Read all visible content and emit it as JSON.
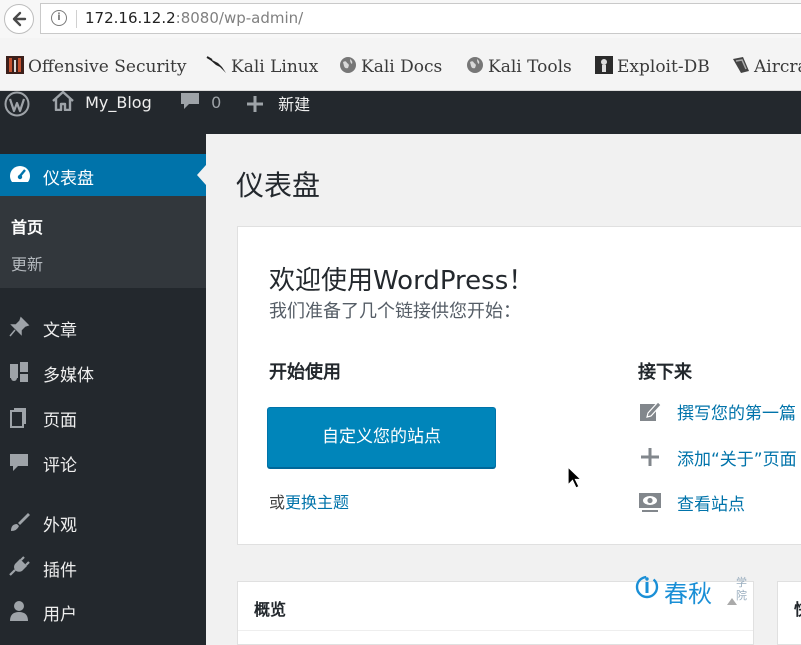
{
  "browser": {
    "url_host": "172.16.12.2",
    "url_rest": ":8080/wp-admin/",
    "bookmarks": [
      "Offensive Security",
      "Kali Linux",
      "Kali Docs",
      "Kali Tools",
      "Exploit-DB",
      "Aircra"
    ]
  },
  "adminbar": {
    "site_name": "My_Blog",
    "comments_count": "0",
    "new_label": "新建"
  },
  "sidebar": {
    "dashboard": "仪表盘",
    "submenu": [
      "首页",
      "更新"
    ],
    "items": [
      "文章",
      "多媒体",
      "页面",
      "评论",
      "外观",
      "插件",
      "用户"
    ]
  },
  "main": {
    "title": "仪表盘",
    "welcome": {
      "title": "欢迎使用WordPress！",
      "subtitle": "我们准备了几个链接供您开始：",
      "get_started": "开始使用",
      "customize_button": "自定义您的站点",
      "or_text": "或",
      "change_theme": "更换主题",
      "next_steps": "接下来",
      "next_items": [
        "撰写您的第一篇",
        "添加“关于”页面",
        "查看站点"
      ]
    },
    "overview": {
      "title": "概览"
    },
    "activity": {
      "title": "快"
    }
  },
  "watermark": {
    "text": "春秋",
    "side": [
      "学",
      "院"
    ]
  },
  "colors": {
    "admin_bg": "#23282d",
    "accent": "#0073aa",
    "button": "#0085ba"
  }
}
